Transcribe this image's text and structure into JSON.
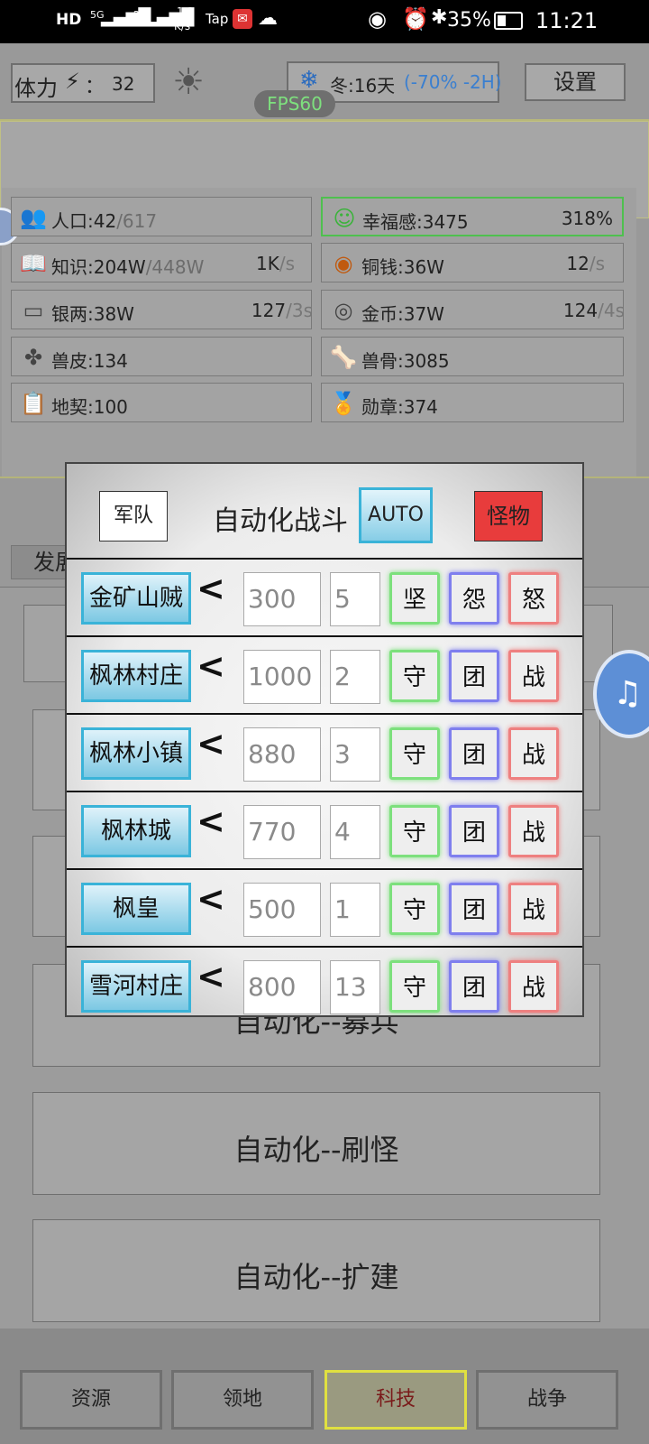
{
  "status_bar": {
    "network_labels": [
      "HD",
      "5G",
      "2G"
    ],
    "speed": "1.2",
    "speed_unit": "K/s",
    "tap_label": "Tap",
    "battery": "35%",
    "time": "11:21"
  },
  "header": {
    "stamina_label": "体力",
    "stamina_sep": "：",
    "stamina_value": "32",
    "season_text": "冬:16天",
    "season_effect": "(-70% -2H)",
    "settings_label": "设置",
    "fps_label": "FPS60"
  },
  "resources": {
    "population": {
      "label": "人口:42",
      "max": "/617"
    },
    "happiness": {
      "label": "幸福感:3475",
      "rate": "318%"
    },
    "knowledge": {
      "label": "知识:204W",
      "max": "/448W",
      "rate": "1K",
      "unit": "/s"
    },
    "copper": {
      "label": "铜钱:36W",
      "rate": "12",
      "unit": "/s"
    },
    "silver": {
      "label": "银两:38W",
      "rate": "127",
      "unit": "/3s"
    },
    "gold": {
      "label": "金币:37W",
      "rate": "124",
      "unit": "/4s"
    },
    "hide": {
      "label": "兽皮:134"
    },
    "bone": {
      "label": "兽骨:3085"
    },
    "deed": {
      "label": "地契:100"
    },
    "medal": {
      "label": "勋章:374"
    }
  },
  "background": {
    "tab_partial": "发展",
    "buttons": [
      "自动化--募兵",
      "自动化--刷怪",
      "自动化--扩建"
    ]
  },
  "bottom_nav": [
    "资源",
    "领地",
    "科技",
    "战争"
  ],
  "modal": {
    "army_button": "军队",
    "title": "自动化战斗",
    "auto_button": "AUTO",
    "monster_button": "怪物",
    "less_than": "<",
    "rows": [
      {
        "name": "金矿山贼",
        "value": "300",
        "count": "5",
        "a1": "坚",
        "a2": "怨",
        "a3": "怒"
      },
      {
        "name": "枫林村庄",
        "value": "1000",
        "count": "2",
        "a1": "守",
        "a2": "团",
        "a3": "战"
      },
      {
        "name": "枫林小镇",
        "value": "880",
        "count": "3",
        "a1": "守",
        "a2": "团",
        "a3": "战"
      },
      {
        "name": "枫林城",
        "value": "770",
        "count": "4",
        "a1": "守",
        "a2": "团",
        "a3": "战"
      },
      {
        "name": "枫皇",
        "value": "500",
        "count": "1",
        "a1": "守",
        "a2": "团",
        "a3": "战"
      },
      {
        "name": "雪河村庄",
        "value": "800",
        "count": "13",
        "a1": "守",
        "a2": "团",
        "a3": "战"
      }
    ]
  },
  "colors": {
    "happiness_border": "#4fc04f",
    "season_effect": "#3a7fd0",
    "fps_text": "#7ee07e",
    "monster_button": "#e83c3c",
    "auto_button": "#3ab3d8",
    "war_tab_border": "#e0e040"
  }
}
